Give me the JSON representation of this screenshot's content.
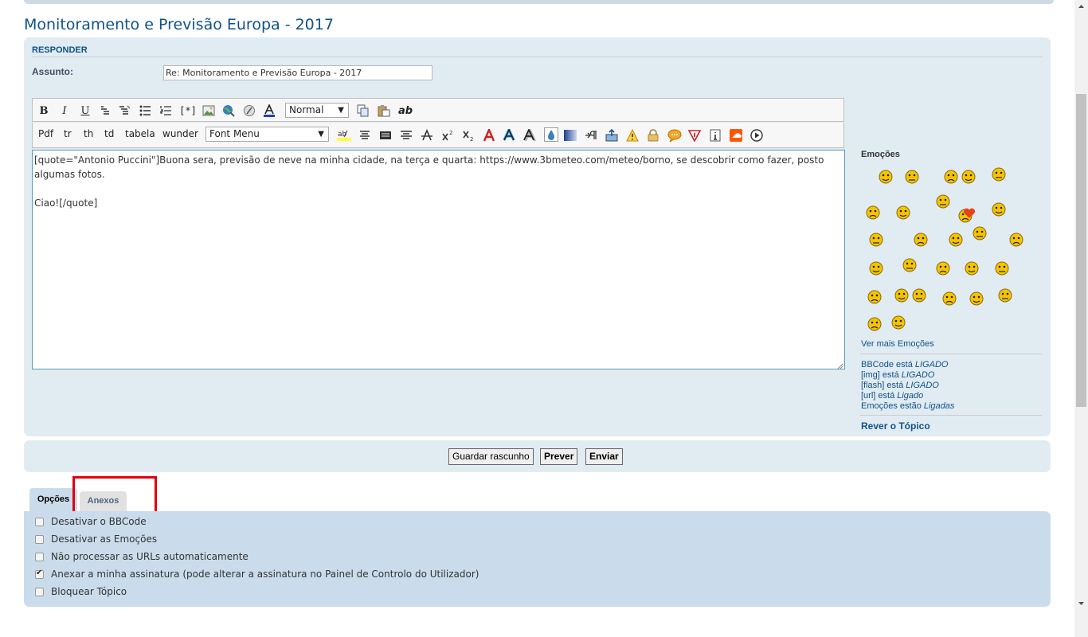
{
  "page": {
    "title": "Monitoramento e Previsão Europa - 2017"
  },
  "form": {
    "section_label": "RESPONDER",
    "subject_label": "Assunto:",
    "subject_value": "Re: Monitoramento e Previsão Europa - 2017"
  },
  "toolbar": {
    "row1": {
      "icons": [
        "bold-icon",
        "italic-icon",
        "underline-icon",
        "quote-icon",
        "code-icon",
        "bullet-list-icon",
        "numbered-list-icon",
        "list-item-icon",
        "image-icon",
        "url-icon",
        "flash-icon",
        "font-color-icon",
        "copy-icon",
        "paste-icon",
        "spellcheck-icon"
      ],
      "bold": "B",
      "italic": "I",
      "underline": "U",
      "list_item": "[*]",
      "spellcheck": "ab",
      "size_select": "Normal"
    },
    "row2": {
      "text_buttons": [
        "Pdf",
        "tr",
        "th",
        "td",
        "tabela",
        "wunder"
      ],
      "font_select": "Font Menu",
      "icons": [
        "highlight-icon",
        "align-center-icon",
        "justify-icon",
        "align-center-2-icon",
        "strikethrough-icon",
        "superscript-icon",
        "subscript-icon",
        "acronym-icon",
        "glow-icon",
        "shadow-icon",
        "drop-icon",
        "gradient-icon",
        "direction-icon",
        "upload-icon",
        "warning-icon",
        "lock-icon",
        "speech-icon",
        "spoiler-icon",
        "info-icon",
        "soundcloud-icon",
        "play-icon"
      ]
    }
  },
  "editor": {
    "content": "[quote=\"Antonio Puccini\"]Buona sera, previsão de neve na minha cidade, na terça e quarta: https://www.3bmeteo.com/meteo/borno, se descobrir como fazer, posto algumas fotos.\n\nCiao![/quote]"
  },
  "sidebar": {
    "emotions_title": "Emoções",
    "more_emotions": "Ver mais Emoções",
    "status": [
      {
        "label": "BBCode está ",
        "value": "LIGADO"
      },
      {
        "label": "[img] está ",
        "value": "LIGADO"
      },
      {
        "label": "[flash] está ",
        "value": "LIGADO"
      },
      {
        "label": "[url] está ",
        "value": "Ligado"
      },
      {
        "label": "Emoções estão ",
        "value": "Ligadas"
      }
    ],
    "review_topic": "Rever o Tópico"
  },
  "buttons": {
    "save_draft": "Guardar rascunho",
    "preview": "Prever",
    "submit": "Enviar"
  },
  "tabs": {
    "options": "Opções",
    "attachments": "Anexos"
  },
  "options": [
    {
      "label": "Desativar o BBCode",
      "checked": false
    },
    {
      "label": "Desativar as Emoções",
      "checked": false
    },
    {
      "label": "Não processar as URLs automaticamente",
      "checked": false
    },
    {
      "label": "Anexar a minha assinatura (pode alterar a assinatura no Painel de Controlo do Utilizador)",
      "checked": true
    },
    {
      "label": "Bloquear Tópico",
      "checked": false
    }
  ],
  "colors": {
    "title": "#105289",
    "panel": "#e1ebf2",
    "options_panel": "#cadceb",
    "highlight_box": "#e2000f",
    "smiley": "#f5c400"
  }
}
